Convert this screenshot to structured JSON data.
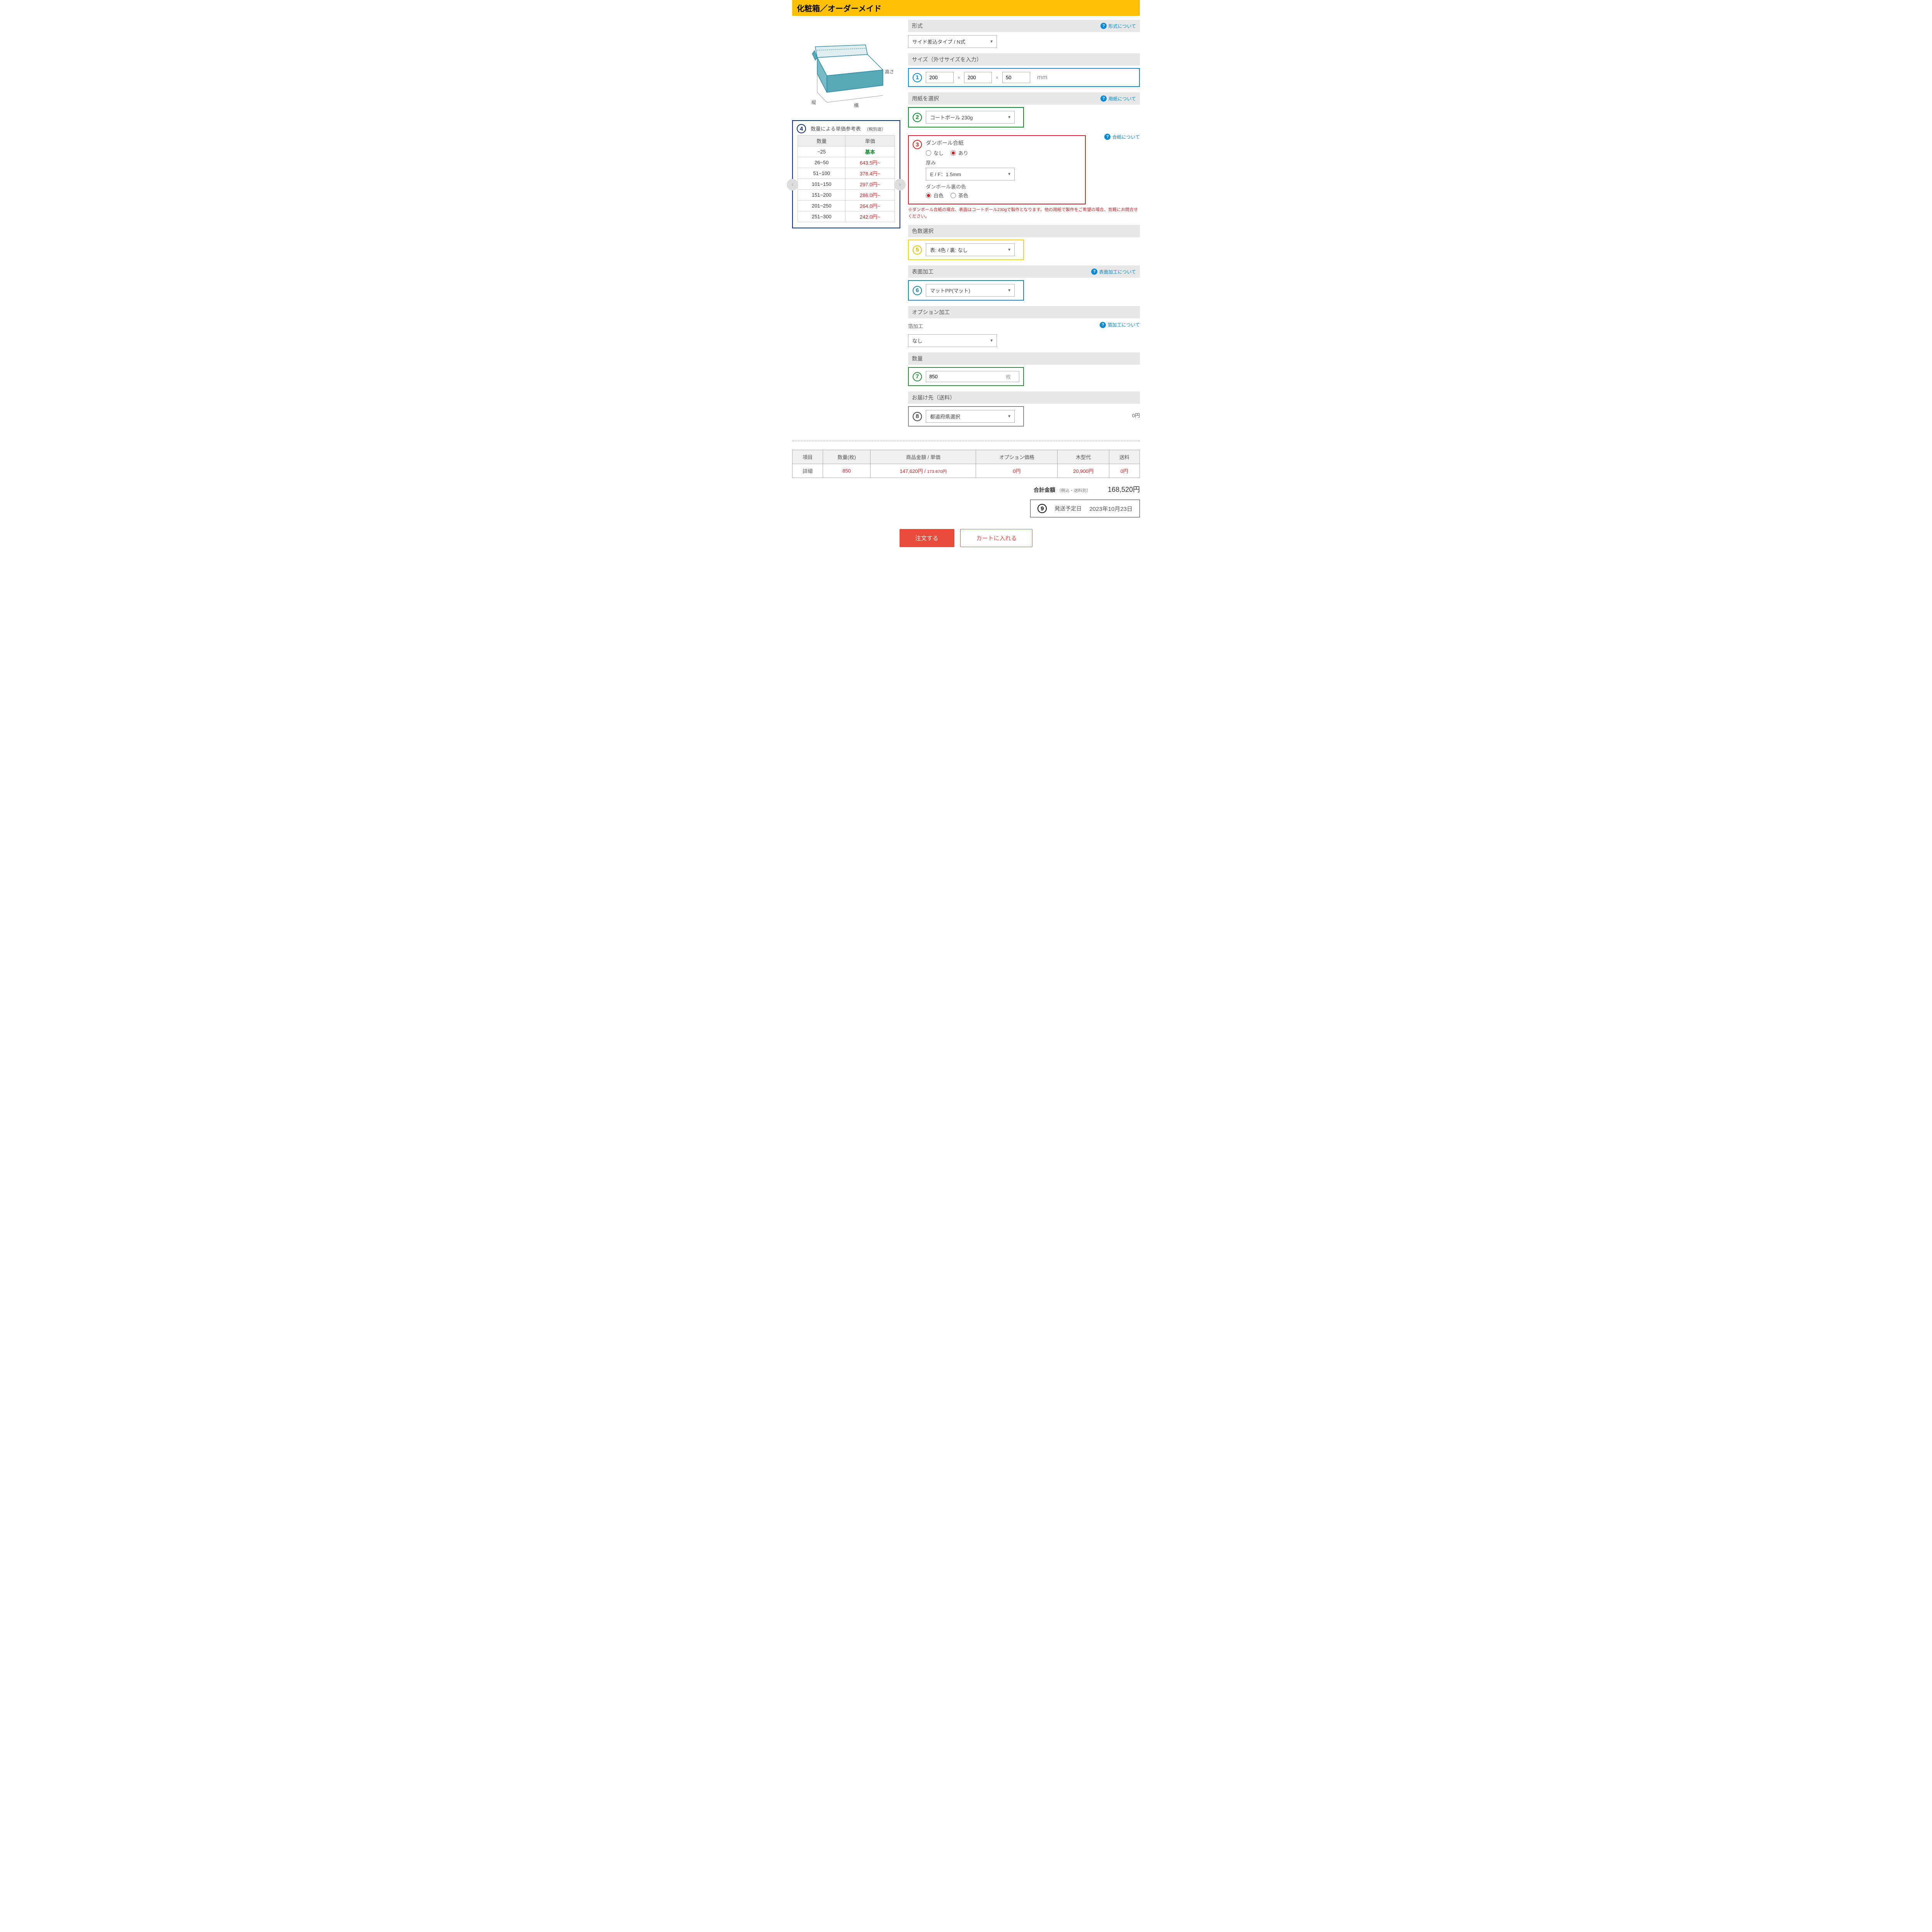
{
  "title": "化粧箱／オーダーメイド",
  "illustration": {
    "dim_height": "高さ",
    "dim_depth": "縦",
    "dim_width": "横"
  },
  "priceTable": {
    "num": "4",
    "caption": "数量による単価参考表",
    "caption_note": "（税別途）",
    "headers": [
      "数量",
      "単価"
    ],
    "rows": [
      {
        "qty": "~25",
        "price": "基本",
        "base": true
      },
      {
        "qty": "26~50",
        "price": "643.5円~"
      },
      {
        "qty": "51~100",
        "price": "378.4円~"
      },
      {
        "qty": "101~150",
        "price": "297.0円~"
      },
      {
        "qty": "151~200",
        "price": "286.0円~"
      },
      {
        "qty": "201~250",
        "price": "264.0円~"
      },
      {
        "qty": "251~300",
        "price": "242.0円~"
      }
    ]
  },
  "form": {
    "type": {
      "label": "形式",
      "help": "形式について",
      "value": "サイド差込タイプ / N式"
    },
    "size": {
      "num": "1",
      "label": "サイズ（外寸サイズを入力）",
      "w": "200",
      "d": "200",
      "h": "50",
      "unit": "mm"
    },
    "paper": {
      "num": "2",
      "label": "用紙を選択",
      "help": "用紙について",
      "value": "コートボール 230g"
    },
    "laminate": {
      "num": "3",
      "label": "ダンボール合紙",
      "help": "合紙について",
      "opt_no": "なし",
      "opt_yes": "あり",
      "thickness_label": "厚み",
      "thickness_value": "E / F：1.5mm",
      "backcolor_label": "ダンボール裏の色",
      "back_white": "白色",
      "back_brown": "茶色",
      "warn": "※ダンボール合紙の場合、表面はコートボール230gで製作となります。他の用紙で製作をご希望の場合、気軽にお問合せください。"
    },
    "colors": {
      "num": "5",
      "label": "色数選択",
      "value": "表: 4色 / 裏: なし"
    },
    "finish": {
      "num": "6",
      "label": "表面加工",
      "help": "表面加工について",
      "value": "マットPP(マット)"
    },
    "option": {
      "label": "オプション加工",
      "foil_label": "箔加工",
      "foil_help": "箔加工について",
      "foil_value": "なし"
    },
    "quantity": {
      "num": "7",
      "label": "数量",
      "value": "850",
      "unit": "枚"
    },
    "delivery": {
      "num": "8",
      "label": "お届け先（送料）",
      "value": "都道府県選択",
      "cost": "0円"
    }
  },
  "summary": {
    "headers": [
      "項目",
      "数量(枚)",
      "商品金額 / 単価",
      "オプション価格",
      "木型代",
      "送料"
    ],
    "row_label": "詳細",
    "qty": "850",
    "item_price_main": "147,620円 / ",
    "item_price_sub": "173.670円",
    "option_price": "0円",
    "die_price": "20,900円",
    "shipping": "0円"
  },
  "total": {
    "label": "合計金額",
    "note": "（税込・送料別）",
    "amount": "168,520円"
  },
  "ship": {
    "num": "9",
    "label": "発送予定日",
    "date": "2023年10月23日"
  },
  "buttons": {
    "order": "注文する",
    "cart": "カートに入れる"
  }
}
